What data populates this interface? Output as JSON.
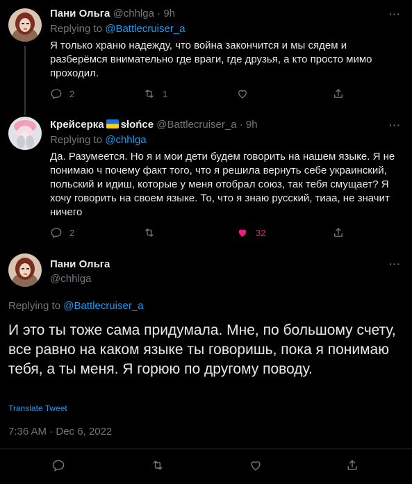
{
  "tweets": [
    {
      "name": "Пани Ольга",
      "handle": "@chhlga",
      "time": "9h",
      "replying_label": "Replying to",
      "replying_to": "@Battlecruiser_a",
      "text": "Я только храню надежду, что война закончится и мы сядем и разберёмся внимательно где враги, где друзья, а кто просто мимо проходил.",
      "replies": "2",
      "retweets": "1",
      "likes": ""
    },
    {
      "name": "Крейсерка",
      "flag": "ukraine-flag",
      "name_suffix": "słońce",
      "handle": "@Battlecruiser_a",
      "time": "9h",
      "replying_label": "Replying to",
      "replying_to": "@chhlga",
      "text": "Да. Разумеется. Но я и мои дети будем говорить на нашем языке. Я не понимаю ч почему факт того, что я решила вернуть себе украинский, польский и идиш, которые у меня отобрал союз, так тебя смущает? Я хочу говорить на своем языке. То, что я знаю русский, тиаа, не значит ничего",
      "replies": "2",
      "retweets": "",
      "likes": "32",
      "like_color": "#f91880"
    }
  ],
  "main": {
    "name": "Пани Ольга",
    "handle": "@chhlga",
    "replying_label": "Replying to",
    "replying_to": "@Battlecruiser_a",
    "text": "И это ты тоже сама придумала. Мне, по большому счету, все равно на каком языке ты говоришь, пока я понимаю тебя, а ты меня. Я горюю по другому поводу.",
    "translate": "Translate Tweet",
    "timestamp": "7:36 AM · Dec 6, 2022"
  },
  "colors": {
    "accent": "#1d9bf0",
    "muted": "#71767b",
    "like": "#f91880",
    "bg": "#000000"
  },
  "dot_separator": "·",
  "more_glyph": "···"
}
